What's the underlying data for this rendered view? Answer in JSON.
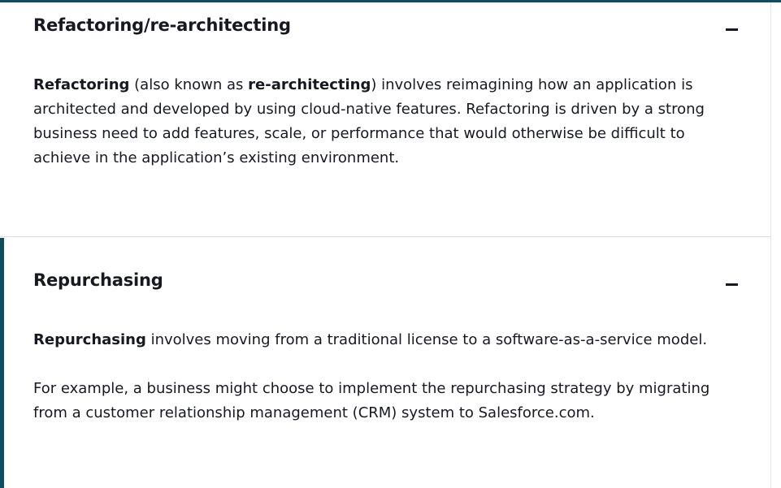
{
  "sections": [
    {
      "title": "Refactoring/re-architecting",
      "toggle_symbol": "−",
      "paragraph": {
        "bold_1": "Refactoring",
        "text_1": " (also known as ",
        "bold_2": "re-architecting",
        "text_2": ") involves reimagining how an application is architected and developed by using cloud-native features. Refactoring is driven by a strong business need to add features, scale, or performance that would otherwise be difficult to achieve in the application’s existing environment."
      }
    },
    {
      "title": "Repurchasing",
      "toggle_symbol": "−",
      "paragraph_1": {
        "bold": "Repurchasing",
        "text": " involves moving from a traditional license to a software-as-a-service model."
      },
      "paragraph_2": "For example, a business might choose to implement the repurchasing strategy by migrating from a customer relationship management (CRM) system to Salesforce.com."
    }
  ],
  "colors": {
    "accent": "#0f4c5c",
    "text": "#16191f",
    "divider": "#dcdfe2"
  }
}
